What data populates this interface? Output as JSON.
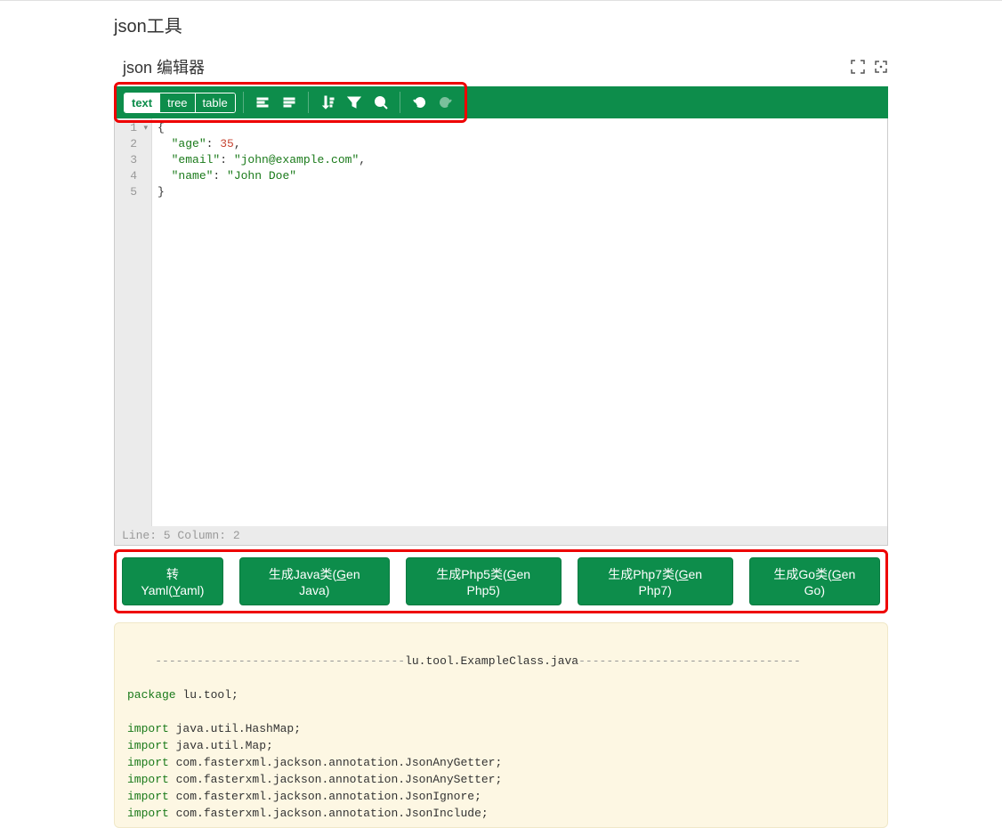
{
  "page_title": "json工具",
  "editor_label": "json 编辑器",
  "modes": [
    "text",
    "tree",
    "table"
  ],
  "active_mode": "text",
  "gutter": [
    "1",
    "2",
    "3",
    "4",
    "5"
  ],
  "code": {
    "l1": "{",
    "l2_k": "\"age\"",
    "l2_v": "35",
    "l3_k": "\"email\"",
    "l3_v": "\"john@example.com\"",
    "l4_k": "\"name\"",
    "l4_v": "\"John Doe\"",
    "l5": "}"
  },
  "status": "Line: 5  Column: 2",
  "actions": {
    "yaml": {
      "pre": "转Yaml(",
      "u": "Y",
      "post": "aml)"
    },
    "java": {
      "pre": "生成Java类(",
      "u": "G",
      "post": "en Java)"
    },
    "php5": {
      "pre": "生成Php5类(",
      "u": "G",
      "post": "en Php5)"
    },
    "php7": {
      "pre": "生成Php7类(",
      "u": "G",
      "post": "en Php7)"
    },
    "go": {
      "pre": "生成Go类(",
      "u": "G",
      "post": "en Go)"
    }
  },
  "output": {
    "sep_left": "------------------------------------",
    "file": "lu.tool.ExampleClass.java",
    "sep_right": "--------------------------------",
    "pkg_kw": "package",
    "pkg": " lu.tool;",
    "imp_kw": "import",
    "imports": [
      " java.util.HashMap;",
      " java.util.Map;",
      " com.fasterxml.jackson.annotation.JsonAnyGetter;",
      " com.fasterxml.jackson.annotation.JsonAnySetter;",
      " com.fasterxml.jackson.annotation.JsonIgnore;",
      " com.fasterxml.jackson.annotation.JsonInclude;"
    ]
  }
}
